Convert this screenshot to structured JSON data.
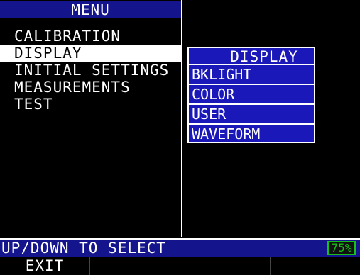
{
  "menu": {
    "title": "MENU",
    "items": [
      {
        "label": "CALIBRATION",
        "selected": false
      },
      {
        "label": "DISPLAY",
        "selected": true
      },
      {
        "label": "INITIAL SETTINGS",
        "selected": false
      },
      {
        "label": "MEASUREMENTS",
        "selected": false
      },
      {
        "label": "TEST",
        "selected": false
      }
    ]
  },
  "submenu": {
    "title": "DISPLAY",
    "items": [
      {
        "label": "BKLIGHT"
      },
      {
        "label": "COLOR"
      },
      {
        "label": "USER"
      },
      {
        "label": "WAVEFORM"
      }
    ]
  },
  "status": {
    "text": "UP/DOWN TO SELECT",
    "battery": "75%"
  },
  "softkeys": [
    {
      "label": "EXIT"
    },
    {
      "label": ""
    },
    {
      "label": ""
    },
    {
      "label": ""
    }
  ],
  "colors": {
    "title_bar": "#14148c",
    "submenu_bg": "#1a18b8",
    "battery": "#16c016"
  }
}
